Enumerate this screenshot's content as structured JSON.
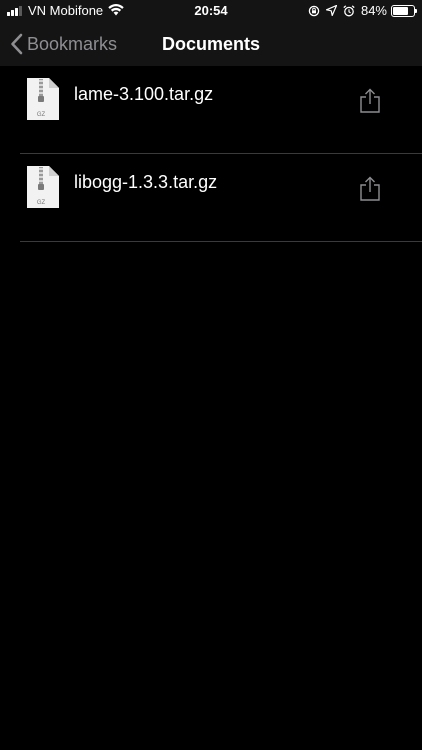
{
  "status_bar": {
    "carrier": "VN Mobifone",
    "time": "20:54",
    "battery_percent": "84%",
    "battery_level": 0.84,
    "icons": [
      "signal-icon",
      "wifi-icon",
      "screen-lock-icon",
      "location-icon",
      "alarm-icon",
      "battery-icon"
    ]
  },
  "nav": {
    "back_label": "Bookmarks",
    "title": "Documents"
  },
  "files": [
    {
      "name": "lame-3.100.tar.gz",
      "type_label": "GZ"
    },
    {
      "name": "libogg-1.3.3.tar.gz",
      "type_label": "GZ"
    }
  ],
  "colors": {
    "background": "#000000",
    "bar": "#141414",
    "back_tint": "#8e8e93",
    "separator": "#3a3a3c",
    "icon_gray": "#8e8e93"
  }
}
